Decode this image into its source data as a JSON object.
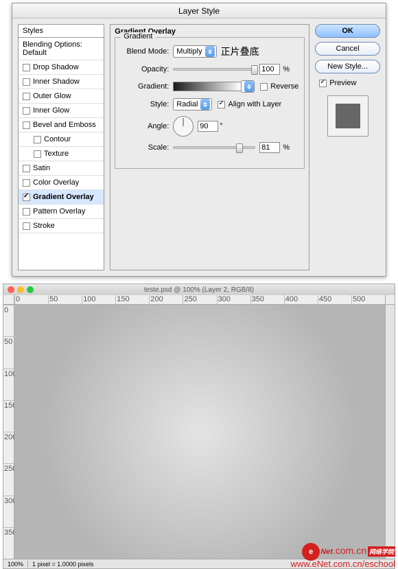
{
  "dialog": {
    "title": "Layer Style",
    "styles_header": "Styles",
    "blending_default": "Blending Options: Default",
    "items": [
      {
        "label": "Drop Shadow",
        "checked": false
      },
      {
        "label": "Inner Shadow",
        "checked": false
      },
      {
        "label": "Outer Glow",
        "checked": false
      },
      {
        "label": "Inner Glow",
        "checked": false
      },
      {
        "label": "Bevel and Emboss",
        "checked": false
      },
      {
        "label": "Contour",
        "checked": false,
        "sub": true
      },
      {
        "label": "Texture",
        "checked": false,
        "sub": true
      },
      {
        "label": "Satin",
        "checked": false
      },
      {
        "label": "Color Overlay",
        "checked": false
      },
      {
        "label": "Gradient Overlay",
        "checked": true,
        "selected": true
      },
      {
        "label": "Pattern Overlay",
        "checked": false
      },
      {
        "label": "Stroke",
        "checked": false
      }
    ],
    "panel_title": "Gradient Overlay",
    "fieldset_title": "Gradient",
    "blend_mode_label": "Blend Mode:",
    "blend_mode_value": "Multiply",
    "blend_mode_annot": "正片叠底",
    "opacity_label": "Opacity:",
    "opacity_value": "100",
    "opacity_unit": "%",
    "gradient_label": "Gradient:",
    "reverse_label": "Reverse",
    "style_label": "Style:",
    "style_value": "Radial",
    "align_label": "Align with Layer",
    "align_checked": true,
    "angle_label": "Angle:",
    "angle_value": "90",
    "angle_unit": "°",
    "scale_label": "Scale:",
    "scale_value": "81",
    "scale_unit": "%"
  },
  "buttons": {
    "ok": "OK",
    "cancel": "Cancel",
    "new_style": "New Style...",
    "preview": "Preview"
  },
  "document": {
    "title": "teste.psd @ 100% (Layer 2, RGB/8)",
    "zoom": "100%",
    "status": "1 pixel = 1.0000 pixels"
  },
  "watermark": {
    "brand_e": "e",
    "brand_rest": "Net",
    "dotcom": ".com.cn",
    "cn_badge": "网络学院",
    "url": "www.eNet.com.cn/eschool"
  }
}
